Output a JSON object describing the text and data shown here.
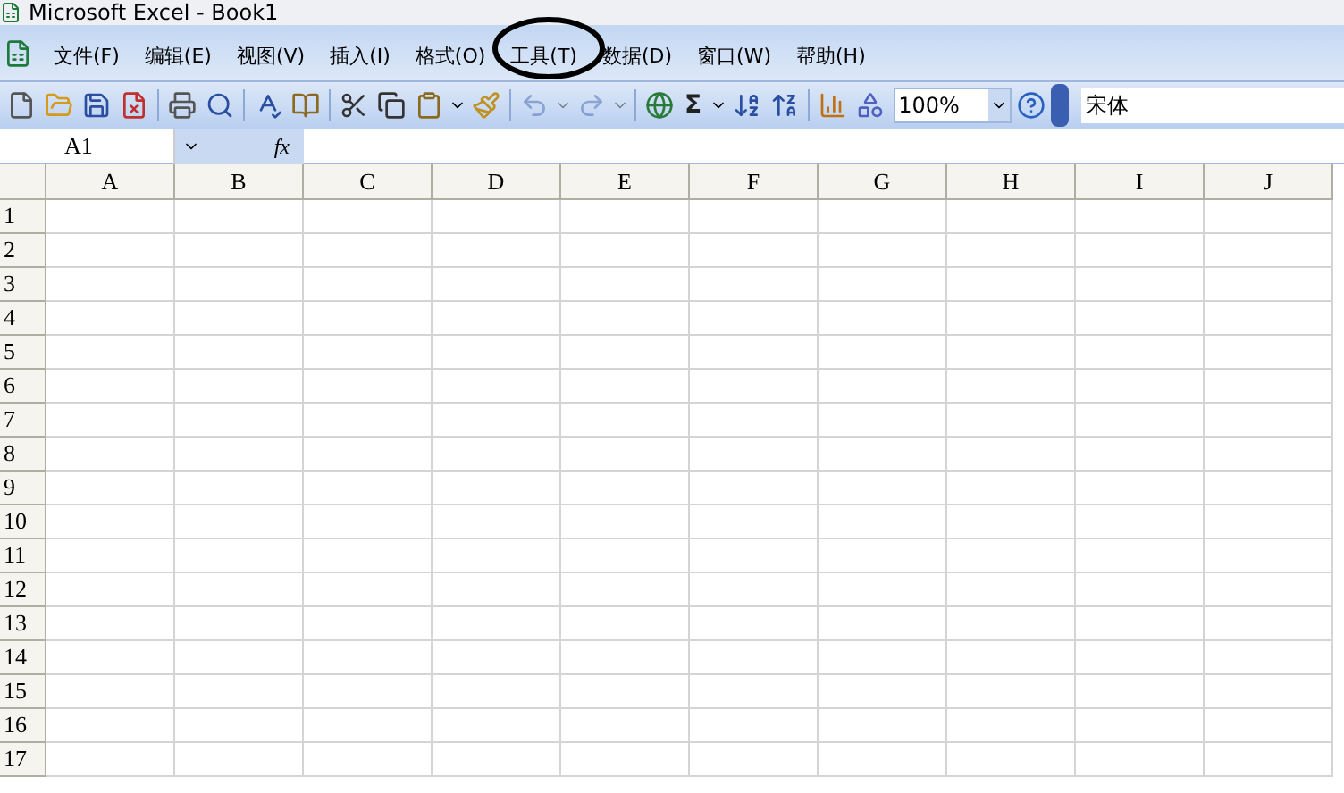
{
  "window": {
    "title": "Microsoft Excel - Book1"
  },
  "menu": [
    {
      "label": "文件(F)",
      "circled": false
    },
    {
      "label": "编辑(E)",
      "circled": false
    },
    {
      "label": "视图(V)",
      "circled": false
    },
    {
      "label": "插入(I)",
      "circled": false
    },
    {
      "label": "格式(O)",
      "circled": false
    },
    {
      "label": "工具(T)",
      "circled": true
    },
    {
      "label": "数据(D)",
      "circled": false
    },
    {
      "label": "窗口(W)",
      "circled": false
    },
    {
      "label": "帮助(H)",
      "circled": false
    }
  ],
  "toolbar": {
    "undo": {
      "disabled": true
    },
    "redo": {
      "disabled": true
    },
    "sum_symbol": "Σ",
    "zoom": "100%",
    "font": "宋体"
  },
  "formula_bar": {
    "name_box": "A1",
    "fx_label": "fx"
  },
  "sheet": {
    "columns": [
      "A",
      "B",
      "C",
      "D",
      "E",
      "F",
      "G",
      "H",
      "I",
      "J"
    ],
    "rows": [
      "1",
      "2",
      "3",
      "4",
      "5",
      "6",
      "7",
      "8",
      "9",
      "10",
      "11",
      "12",
      "13",
      "14",
      "15",
      "16",
      "17"
    ]
  }
}
